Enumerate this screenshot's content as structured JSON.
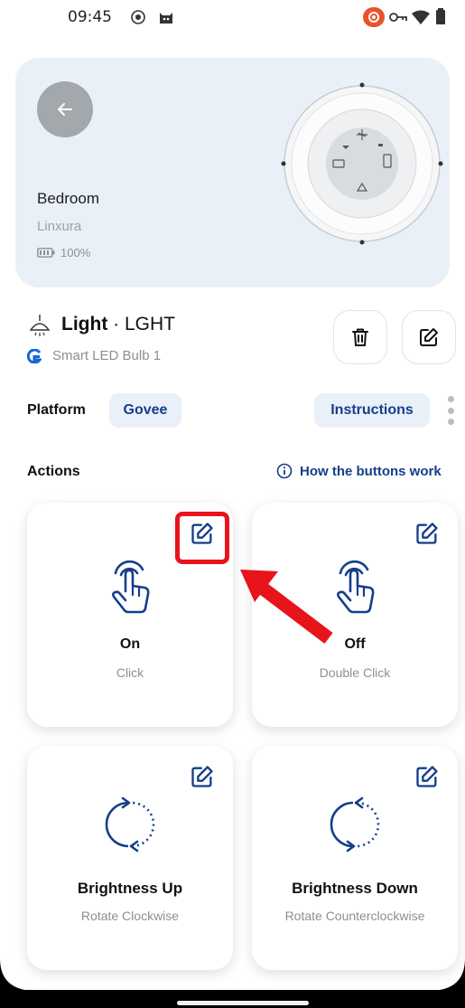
{
  "status_bar": {
    "time": "09:45"
  },
  "device": {
    "name": "Bedroom",
    "brand": "Linxura",
    "battery": "100%"
  },
  "light": {
    "title": "Light",
    "separator": " · ",
    "code": "LGHT",
    "model": "Smart LED Bulb 1"
  },
  "platform": {
    "label": "Platform",
    "value": "Govee",
    "instructions_label": "Instructions"
  },
  "actions": {
    "label": "Actions",
    "how_link": "How the buttons work",
    "items": [
      {
        "name": "On",
        "trigger": "Click",
        "icon": "tap-hand-icon"
      },
      {
        "name": "Off",
        "trigger": "Double Click",
        "icon": "tap-hand-icon"
      },
      {
        "name": "Brightness Up",
        "trigger": "Rotate Clockwise",
        "icon": "rotate-clockwise-icon"
      },
      {
        "name": "Brightness Down",
        "trigger": "Rotate Counterclockwise",
        "icon": "rotate-counterclockwise-icon"
      }
    ]
  },
  "colors": {
    "accent": "#153e8b",
    "card_bg": "#e9f0f8",
    "annotation_red": "#e8141b"
  }
}
